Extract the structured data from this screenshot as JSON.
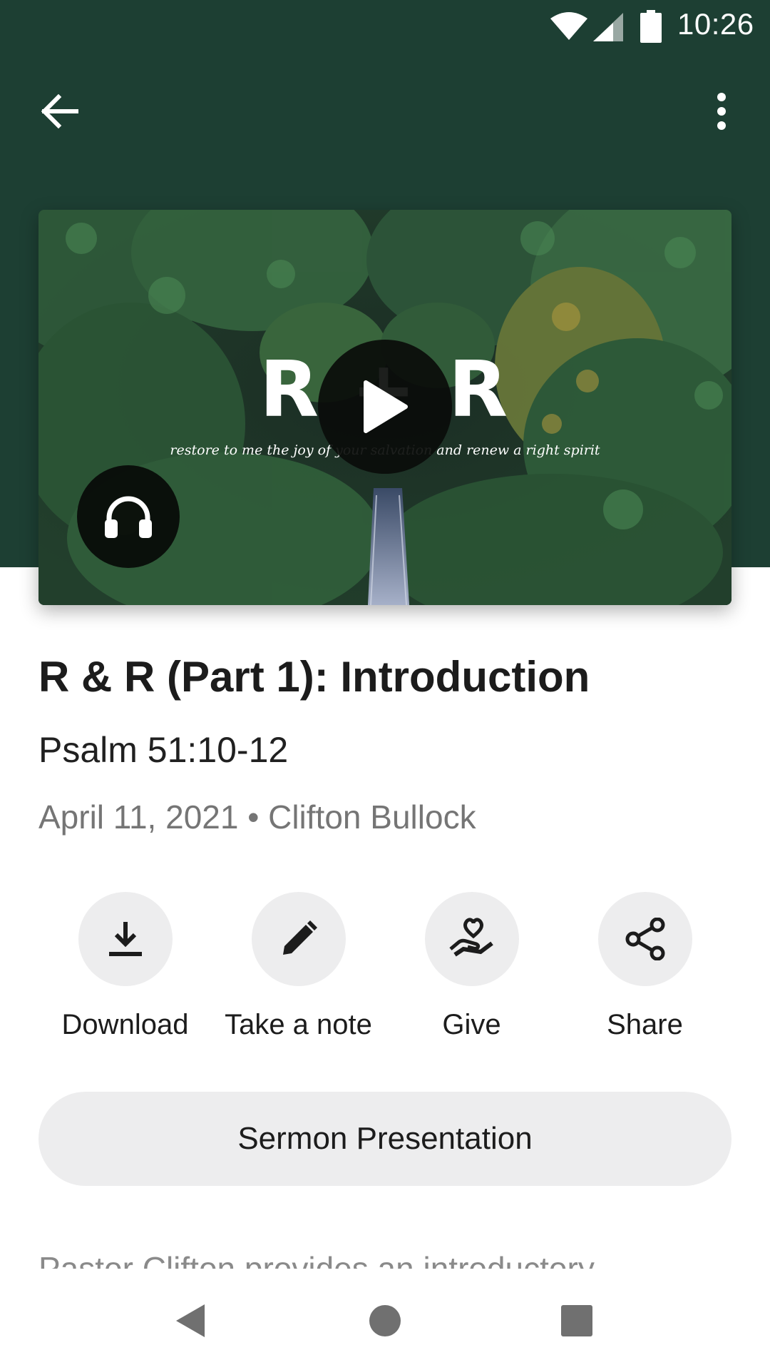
{
  "status_bar": {
    "time": "10:26",
    "icons": [
      "wifi-icon",
      "cell-signal-icon",
      "battery-icon"
    ]
  },
  "toolbar": {
    "back_icon": "arrow-back-icon",
    "menu_icon": "more-vert-icon"
  },
  "artwork": {
    "letters": "R + R",
    "tagline": "restore to me the joy of your salvation and renew a right spirit",
    "play_icon": "play-icon",
    "audio_icon": "headphones-icon"
  },
  "sermon": {
    "title": "R & R (Part 1): Introduction",
    "scripture": "Psalm 51:10-12",
    "meta": "April 11, 2021 • Clifton Bullock",
    "description": "Pastor Clifton provides an introductory"
  },
  "actions": [
    {
      "label": "Download",
      "icon": "download-icon"
    },
    {
      "label": "Take a note",
      "icon": "pencil-icon"
    },
    {
      "label": "Give",
      "icon": "give-heart-hand-icon"
    },
    {
      "label": "Share",
      "icon": "share-icon"
    }
  ],
  "presentation_button": {
    "label": "Sermon Presentation"
  },
  "nav_bar": {
    "icons": [
      "nav-back-icon",
      "nav-home-icon",
      "nav-recents-icon"
    ]
  },
  "colors": {
    "header": "#1d3f33",
    "button_bg": "#ededee",
    "text_primary": "#1c1c1c",
    "text_secondary": "#757575"
  }
}
